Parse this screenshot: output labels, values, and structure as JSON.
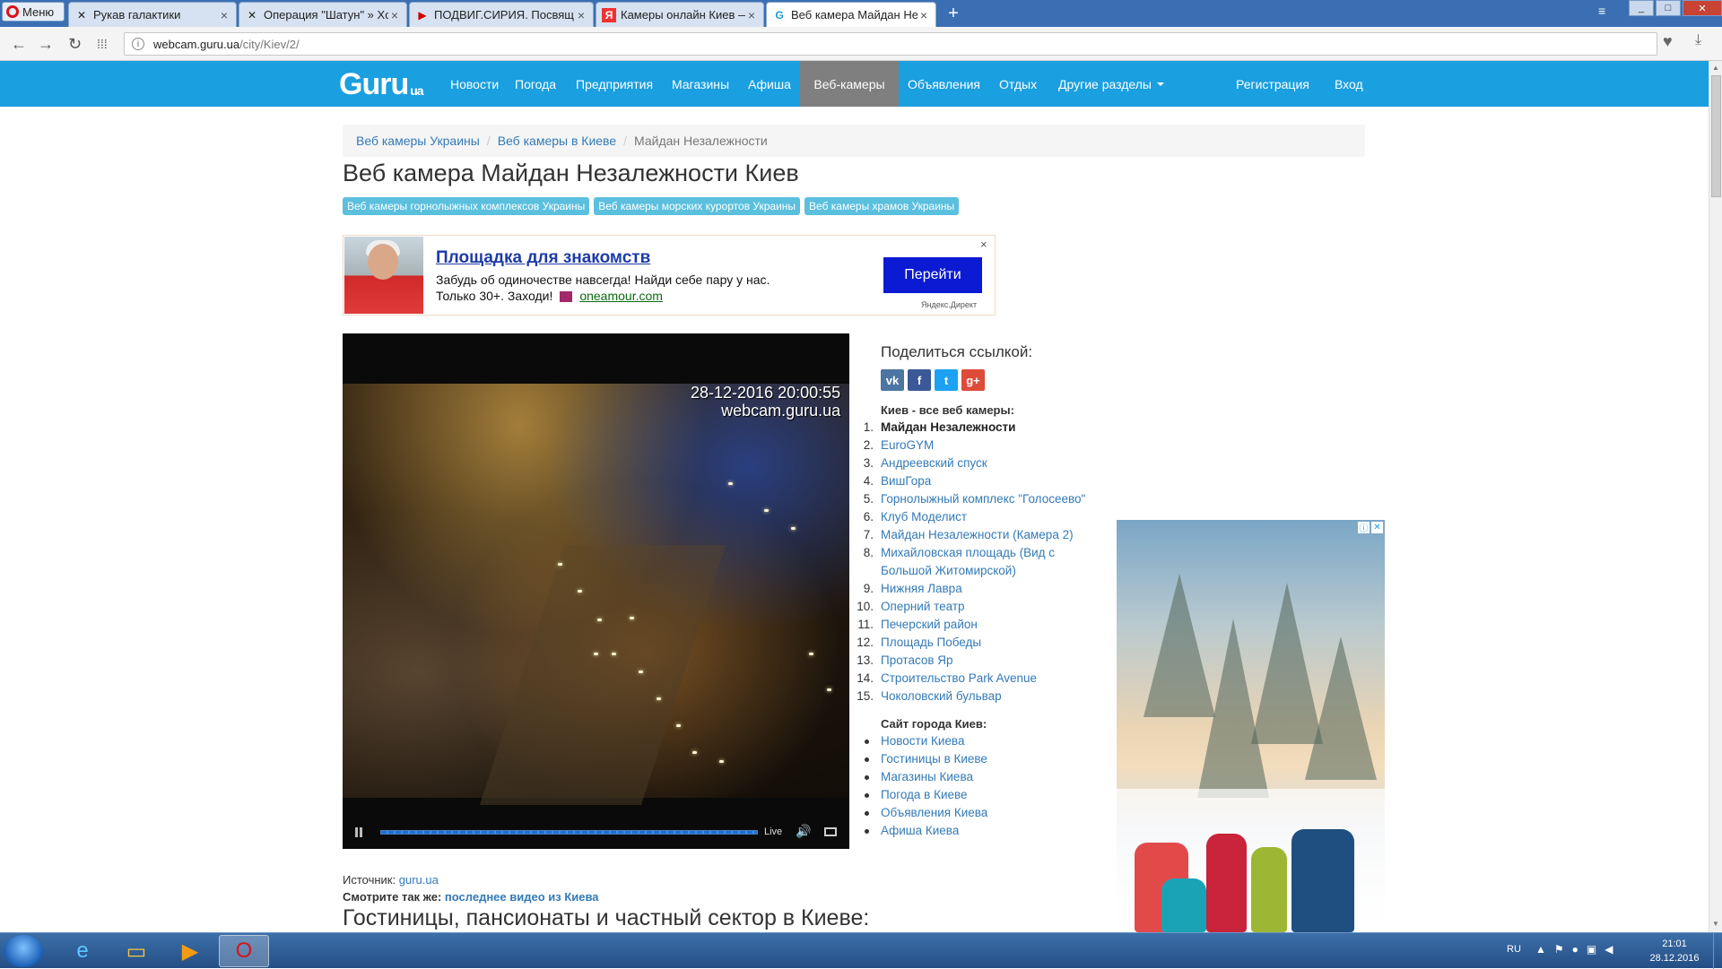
{
  "browser": {
    "menu_label": "Меню",
    "tabs": [
      {
        "label": "Рукав галактики",
        "active": false
      },
      {
        "label": "Операция \"Шатун\" » Хсг",
        "active": false
      },
      {
        "label": "ПОДВИГ.СИРИЯ. Посвящ",
        "active": false
      },
      {
        "label": "Камеры онлайн Киев — ",
        "active": false
      },
      {
        "label": "Веб камера Майдан Неза",
        "active": true
      }
    ],
    "url_host": "webcam.guru.ua",
    "url_path": "/city/Kiev/2/"
  },
  "site": {
    "logo": "Guru",
    "logo_suffix": "ua",
    "nav": [
      {
        "label": "Новости",
        "active": false
      },
      {
        "label": "Погода",
        "active": false
      },
      {
        "label": "Предприятия",
        "active": false
      },
      {
        "label": "Магазины",
        "active": false
      },
      {
        "label": "Афиша",
        "active": false
      },
      {
        "label": "Веб-камеры",
        "active": true
      },
      {
        "label": "Объявления",
        "active": false
      },
      {
        "label": "Отдых",
        "active": false
      },
      {
        "label": "Другие разделы",
        "active": false
      }
    ],
    "register_label": "Регистрация",
    "login_label": "Вход"
  },
  "breadcrumb": {
    "items": [
      "Веб камеры Украины",
      "Веб камеры в Киеве"
    ],
    "current": "Майдан Незалежности"
  },
  "page_title": "Веб камера Майдан Незалежности Киев",
  "tags": [
    "Веб камеры горнолыжных комплексов Украины",
    "Веб камеры морских курортов Украины",
    "Веб камеры храмов Украины"
  ],
  "ad": {
    "title": "Площадка для знакомств",
    "text": "Забудь об одиночестве навсегда! Найди себе пару у нас. Только 30+. Заходи!",
    "domain": "oneamour.com",
    "button": "Перейти",
    "close": "×",
    "source": "Яндекс.Директ"
  },
  "video": {
    "timestamp": "28-12-2016 20:00:55",
    "watermark": "webcam.guru.ua",
    "live_label": "Live"
  },
  "share": {
    "label": "Поделиться ссылкой:",
    "icons": [
      "vk",
      "f",
      "t",
      "g+"
    ]
  },
  "cams": {
    "title": "Киев - все веб камеры:",
    "items": [
      "Майдан Незалежности",
      "EuroGYM",
      "Андреевский спуск",
      "ВишГора",
      "Горнолыжный комплекс \"Голосеево\"",
      "Клуб Моделист",
      "Майдан Незалежности (Камера 2)",
      "Михайловская площадь (Вид с Большой Житомирской)",
      "Нижняя Лавра",
      "Оперний театр",
      "Печерский район",
      "Площадь Победы",
      "Протасов Яр",
      "Строительство Park Avenue",
      "Чоколовский бульвар"
    ],
    "current_index": 0
  },
  "city_site": {
    "title": "Сайт города Киев:",
    "items": [
      "Новости Киева",
      "Гостиницы в Киеве",
      "Магазины Киева",
      "Погода в Киеве",
      "Объявления Киева",
      "Афиша Киева"
    ]
  },
  "source": {
    "label": "Источник:",
    "link": "guru.ua"
  },
  "see_also": {
    "label": "Смотрите так же:",
    "link": "последнее видео из Киева"
  },
  "hotels_heading": "Гостиницы, пансионаты и частный сектор в Киеве:",
  "taskbar": {
    "lang": "RU",
    "time": "21:01",
    "date": "28.12.2016"
  },
  "colors": {
    "nav_bg": "#1a9fe0",
    "nav_active": "#7f7f7f",
    "link": "#337ab7",
    "tag_bg": "#5bc0de",
    "ad_button": "#0b1bd3"
  }
}
